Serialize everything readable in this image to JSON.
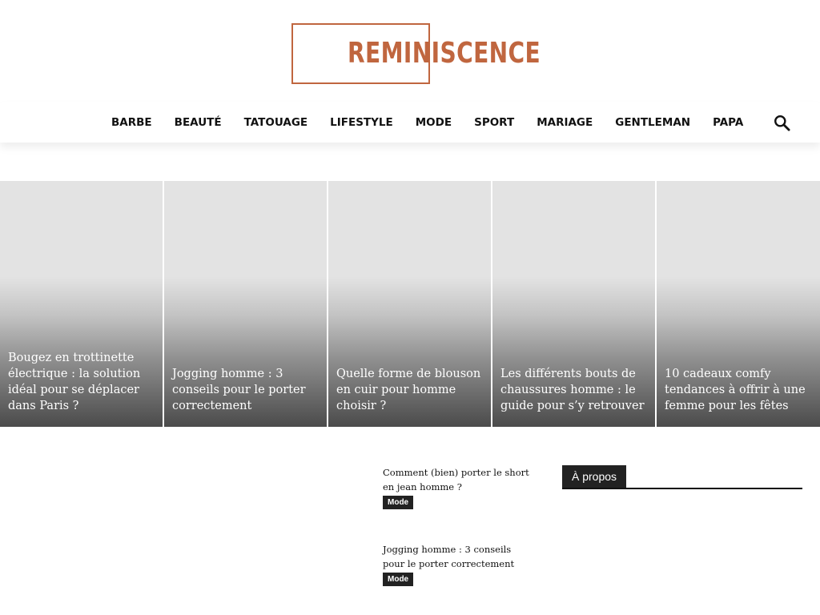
{
  "brand": {
    "name": "REMINISCENCE",
    "color": "#c0663f"
  },
  "nav": {
    "items": [
      {
        "label": "BARBE"
      },
      {
        "label": "BEAUTÉ"
      },
      {
        "label": "TATOUAGE"
      },
      {
        "label": "LIFESTYLE"
      },
      {
        "label": "MODE"
      },
      {
        "label": "SPORT"
      },
      {
        "label": "MARIAGE"
      },
      {
        "label": "GENTLEMAN"
      },
      {
        "label": "PAPA"
      }
    ],
    "search_icon": "search-icon"
  },
  "featured": [
    {
      "title": "Bougez en trottinette électrique : la solution idéal pour se déplacer dans Paris ?"
    },
    {
      "title": "Jogging homme : 3 conseils pour le porter correctement"
    },
    {
      "title": "Quelle forme de blouson en cuir pour homme choisir ?"
    },
    {
      "title": "Les différents bouts de chaussures homme : le guide pour s’y retrouver"
    },
    {
      "title": "10 cadeaux comfy tendances à offrir à une femme pour les fêtes"
    }
  ],
  "posts": [
    {
      "title": "Comment (bien) porter le short en jean homme ?",
      "category": "Mode"
    },
    {
      "title": "Jogging homme : 3 conseils pour le porter correctement",
      "category": "Mode"
    }
  ],
  "sidebar": {
    "widget_title": "À propos"
  }
}
